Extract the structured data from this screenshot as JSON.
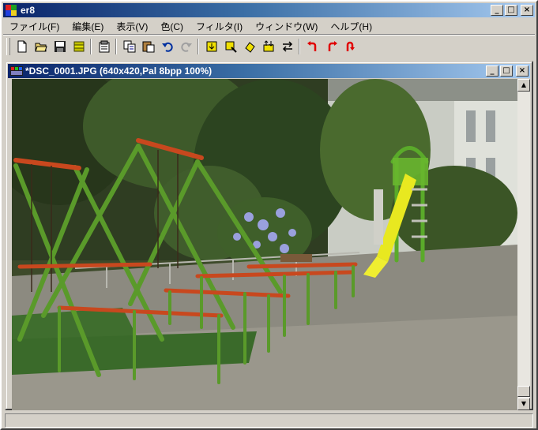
{
  "app": {
    "title": "er8"
  },
  "caption_buttons": {
    "minimize": "_",
    "maximize": "□",
    "close": "×"
  },
  "menu": [
    {
      "label": "ファイル(F)"
    },
    {
      "label": "編集(E)"
    },
    {
      "label": "表示(V)"
    },
    {
      "label": "色(C)"
    },
    {
      "label": "フィルタ(I)"
    },
    {
      "label": "ウィンドウ(W)"
    },
    {
      "label": "ヘルプ(H)"
    }
  ],
  "toolbar": [
    {
      "icon": "new-file-icon"
    },
    {
      "icon": "open-folder-icon"
    },
    {
      "icon": "save-icon"
    },
    {
      "icon": "save-all-icon"
    },
    {
      "icon": "properties-icon"
    },
    {
      "icon": "copy-icon"
    },
    {
      "icon": "paste-icon"
    },
    {
      "icon": "undo-icon"
    },
    {
      "icon": "redo-icon"
    },
    {
      "icon": "resize-icon"
    },
    {
      "icon": "crop-icon"
    },
    {
      "icon": "rotate-icon"
    },
    {
      "icon": "flip-vertical-icon"
    },
    {
      "icon": "flip-horizontal-icon"
    },
    {
      "icon": "rotate-left-icon"
    },
    {
      "icon": "rotate-right-icon"
    },
    {
      "icon": "rotate-180-icon"
    }
  ],
  "document": {
    "title": "*DSC_0001.JPG (640x420,Pal 8bpp 100%)",
    "image_subject": "playground-photo"
  },
  "scrollbar": {
    "up": "▲",
    "down": "▼"
  },
  "status": {
    "text": ""
  },
  "colors": {
    "title_active_start": "#0a246a",
    "title_active_end": "#a6caf0",
    "face": "#d4d0c8"
  }
}
